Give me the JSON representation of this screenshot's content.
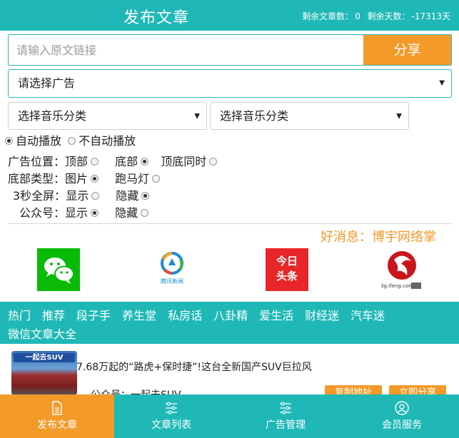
{
  "header": {
    "title": "发布文章",
    "remaining_articles_label": "剩余文章数：",
    "remaining_articles_value": "0",
    "remaining_days_label": "剩余天数：",
    "remaining_days_value": "-17313天"
  },
  "share_form": {
    "url_placeholder": "请输入原文链接",
    "url_value": "",
    "share_label": "分享"
  },
  "ad_select": {
    "selected": "请选择广告"
  },
  "music_select_1": {
    "selected": "选择音乐分类"
  },
  "music_select_2": {
    "selected": "选择音乐分类"
  },
  "autoplay": {
    "options": [
      {
        "label": "自动播放",
        "checked": true
      },
      {
        "label": "不自动播放",
        "checked": false
      }
    ]
  },
  "ad_position": {
    "label": "广告位置：",
    "options": [
      {
        "label": "顶部",
        "checked": false
      },
      {
        "label": "底部",
        "checked": true
      },
      {
        "label": "顶底同时",
        "checked": false
      }
    ]
  },
  "bottom_type": {
    "label": "底部类型：",
    "options": [
      {
        "label": "图片",
        "checked": true
      },
      {
        "label": "跑马灯",
        "checked": false
      }
    ]
  },
  "fullscreen": {
    "label": "3秒全屏：",
    "options": [
      {
        "label": "显示",
        "checked": false
      },
      {
        "label": "隐藏",
        "checked": true
      }
    ]
  },
  "official_account": {
    "label": "公众号：",
    "options": [
      {
        "label": "显示",
        "checked": true
      },
      {
        "label": "隐藏",
        "checked": false
      }
    ]
  },
  "marquee": {
    "text": "好消息：博宇网络掌"
  },
  "sources": {
    "toutiao_line1": "今日",
    "toutiao_line2": "头条",
    "tengxun_caption": "腾讯新闻",
    "ifeng_caption": "3g.ifeng.com"
  },
  "categories": {
    "row1": [
      "热门",
      "推荐",
      "段子手",
      "养生堂",
      "私房话",
      "八卦精",
      "爱生活",
      "财经迷",
      "汽车迷"
    ],
    "row2": "微信文章大全"
  },
  "article": {
    "thumb_label": "一起去SUV",
    "title": "7.68万起的“路虎+保时捷”!这台全新国产SUV巨拉风",
    "account": "公众号：一起去SUV",
    "copy_label": "复制地址",
    "share_label": "立即分享"
  },
  "bottom_nav": {
    "items": [
      {
        "label": "发布文章",
        "active": true,
        "icon": "document-icon"
      },
      {
        "label": "文章列表",
        "active": false,
        "icon": "list-icon"
      },
      {
        "label": "广告管理",
        "active": false,
        "icon": "list-icon"
      },
      {
        "label": "会员服务",
        "active": false,
        "icon": "user-icon"
      }
    ]
  },
  "colors": {
    "brand": "#1fb8b7",
    "accent": "#f39a29"
  }
}
